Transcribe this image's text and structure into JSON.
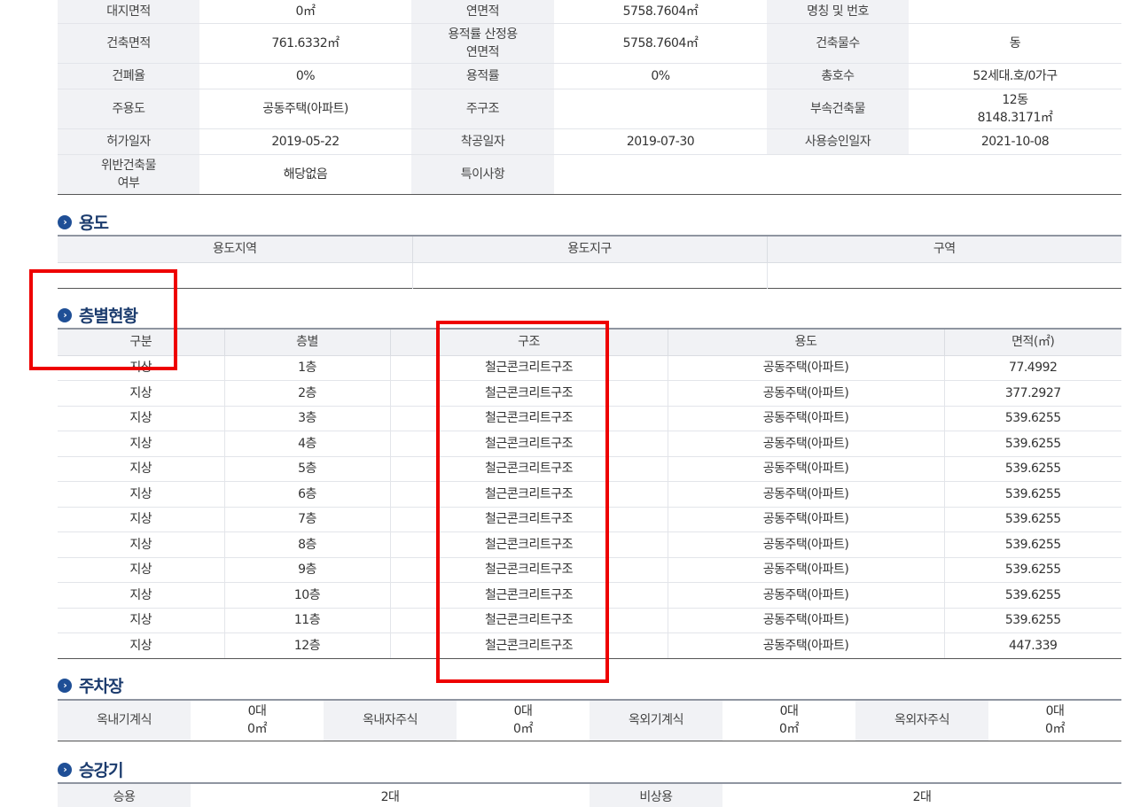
{
  "summary": {
    "rows": [
      [
        {
          "l": "대지면적"
        },
        {
          "v": "0㎡"
        },
        {
          "l": "연면적"
        },
        {
          "v": "5758.7604㎡"
        },
        {
          "l": "명칭 및 번호"
        },
        {
          "v": ""
        }
      ],
      [
        {
          "l": "건축면적"
        },
        {
          "v": "761.6332㎡"
        },
        {
          "l": "용적률 산정용\n연면적"
        },
        {
          "v": "5758.7604㎡"
        },
        {
          "l": "건축물수"
        },
        {
          "v": "동"
        }
      ],
      [
        {
          "l": "건폐율"
        },
        {
          "v": "0%"
        },
        {
          "l": "용적률"
        },
        {
          "v": "0%"
        },
        {
          "l": "총호수"
        },
        {
          "v": "52세대.호/0가구"
        }
      ],
      [
        {
          "l": "주용도"
        },
        {
          "v": "공동주택(아파트)"
        },
        {
          "l": "주구조"
        },
        {
          "v": ""
        },
        {
          "l": "부속건축물"
        },
        {
          "v": "12동\n8148.3171㎡"
        }
      ],
      [
        {
          "l": "허가일자"
        },
        {
          "v": "2019-05-22"
        },
        {
          "l": "착공일자"
        },
        {
          "v": "2019-07-30"
        },
        {
          "l": "사용승인일자"
        },
        {
          "v": "2021-10-08"
        }
      ],
      [
        {
          "l": "위반건축물\n여부"
        },
        {
          "v": "해당없음"
        },
        {
          "l": "특이사항"
        },
        {
          "v": ""
        }
      ]
    ]
  },
  "use": {
    "title": "용도",
    "headers": [
      "용도지역",
      "용도지구",
      "구역"
    ]
  },
  "floors": {
    "title": "층별현황",
    "headers": [
      "구분",
      "층별",
      "구조",
      "용도",
      "면적(㎡)"
    ],
    "rows": [
      [
        "지상",
        "1층",
        "철근콘크리트구조",
        "공동주택(아파트)",
        "77.4992"
      ],
      [
        "지상",
        "2층",
        "철근콘크리트구조",
        "공동주택(아파트)",
        "377.2927"
      ],
      [
        "지상",
        "3층",
        "철근콘크리트구조",
        "공동주택(아파트)",
        "539.6255"
      ],
      [
        "지상",
        "4층",
        "철근콘크리트구조",
        "공동주택(아파트)",
        "539.6255"
      ],
      [
        "지상",
        "5층",
        "철근콘크리트구조",
        "공동주택(아파트)",
        "539.6255"
      ],
      [
        "지상",
        "6층",
        "철근콘크리트구조",
        "공동주택(아파트)",
        "539.6255"
      ],
      [
        "지상",
        "7층",
        "철근콘크리트구조",
        "공동주택(아파트)",
        "539.6255"
      ],
      [
        "지상",
        "8층",
        "철근콘크리트구조",
        "공동주택(아파트)",
        "539.6255"
      ],
      [
        "지상",
        "9층",
        "철근콘크리트구조",
        "공동주택(아파트)",
        "539.6255"
      ],
      [
        "지상",
        "10층",
        "철근콘크리트구조",
        "공동주택(아파트)",
        "539.6255"
      ],
      [
        "지상",
        "11층",
        "철근콘크리트구조",
        "공동주택(아파트)",
        "539.6255"
      ],
      [
        "지상",
        "12층",
        "철근콘크리트구조",
        "공동주택(아파트)",
        "447.339"
      ]
    ]
  },
  "parking": {
    "title": "주차장",
    "cells": [
      {
        "label": "옥내기계식",
        "count": "0대",
        "area": "0㎡"
      },
      {
        "label": "옥내자주식",
        "count": "0대",
        "area": "0㎡"
      },
      {
        "label": "옥외기계식",
        "count": "0대",
        "area": "0㎡"
      },
      {
        "label": "옥외자주식",
        "count": "0대",
        "area": "0㎡"
      }
    ]
  },
  "elevator": {
    "title": "승강기",
    "cells": [
      {
        "label": "승용",
        "value": "2대"
      },
      {
        "label": "비상용",
        "value": "2대"
      }
    ]
  },
  "icon": "chevron-right-circle-icon",
  "colors": {
    "accent": "#1f4f96",
    "highlight": "#ee0000",
    "label_bg": "#f1f2f5"
  }
}
